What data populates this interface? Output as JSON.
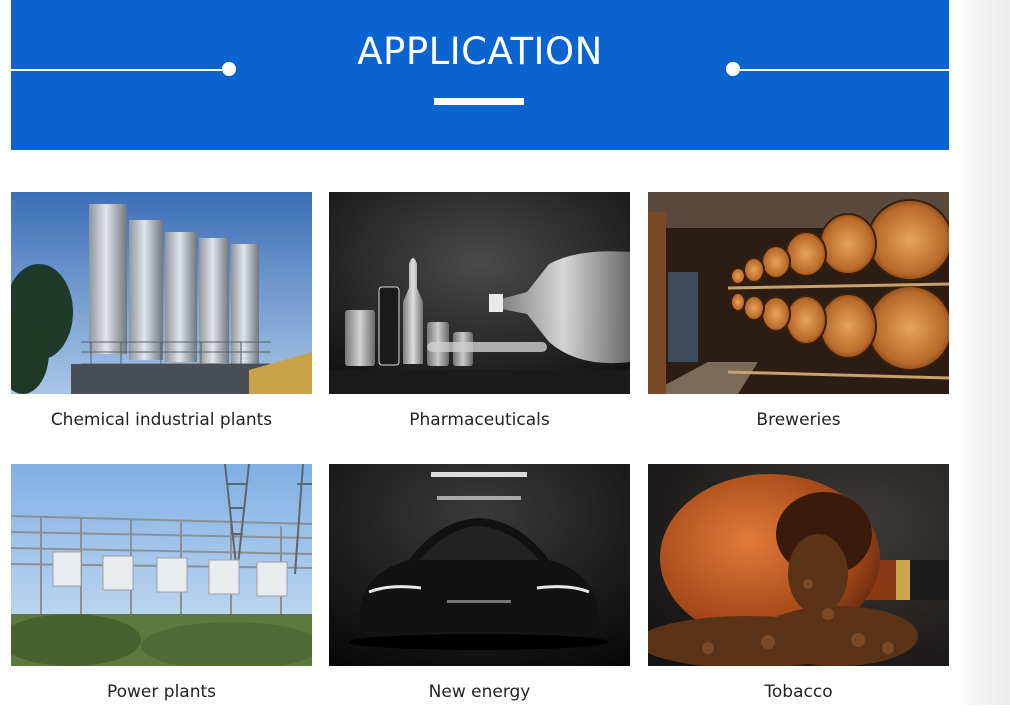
{
  "header": {
    "title": "APPLICATION"
  },
  "applications": [
    {
      "label": "Chemical industrial plants",
      "image": "chemical-plant-silos"
    },
    {
      "label": "Pharmaceuticals",
      "image": "glass-vials"
    },
    {
      "label": "Breweries",
      "image": "wine-barrels"
    },
    {
      "label": "Power plants",
      "image": "power-substation"
    },
    {
      "label": "New energy",
      "image": "dark-car"
    },
    {
      "label": "Tobacco",
      "image": "tobacco-pipe"
    }
  ],
  "colors": {
    "banner": "#0a63cf",
    "text": "#222222"
  }
}
